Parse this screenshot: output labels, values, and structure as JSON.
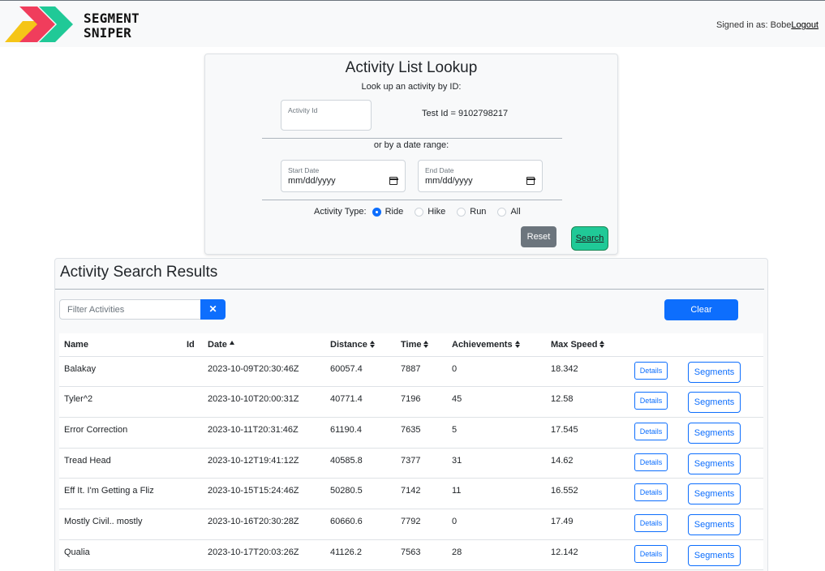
{
  "header": {
    "brand_line1": "SEGMENT",
    "brand_line2": "SNIPER",
    "signed_in_prefix": "Signed in as: Bobe",
    "logout_label": "Logout",
    "logo_colors": [
      "#f5c518",
      "#f03d5c",
      "#20c997"
    ]
  },
  "lookup": {
    "title": "Activity List Lookup",
    "by_id_text": "Look up an activity by ID:",
    "activity_id_label": "Activity Id",
    "activity_id_value": "",
    "test_id_text": "Test Id = 9102798217",
    "by_date_text": "or by a date range:",
    "start_date_label": "Start Date",
    "start_date_value": "mm/dd/yyyy",
    "end_date_label": "End Date",
    "end_date_value": "mm/dd/yyyy",
    "activity_type_label": "Activity Type:",
    "activity_types": [
      {
        "label": "Ride",
        "selected": true
      },
      {
        "label": "Hike",
        "selected": false
      },
      {
        "label": "Run",
        "selected": false
      },
      {
        "label": "All",
        "selected": false
      }
    ],
    "reset_label": "Reset",
    "search_label": "Search"
  },
  "results": {
    "title": "Activity Search Results",
    "filter_placeholder": "Filter Activities",
    "filter_clear_glyph": "✕",
    "clear_label": "Clear",
    "columns": [
      "Name",
      "Id",
      "Date",
      "Distance",
      "Time",
      "Achievements",
      "Max Speed"
    ],
    "details_label": "Details",
    "segments_label": "Segments",
    "rows": [
      {
        "name": "Balakay",
        "id": "",
        "date": "2023-10-09T20:30:46Z",
        "distance": "60057.4",
        "time": "7887",
        "achievements": "0",
        "max_speed": "18.342"
      },
      {
        "name": "Tyler^2",
        "id": "",
        "date": "2023-10-10T20:00:31Z",
        "distance": "40771.4",
        "time": "7196",
        "achievements": "45",
        "max_speed": "12.58"
      },
      {
        "name": "Error Correction",
        "id": "",
        "date": "2023-10-11T20:31:46Z",
        "distance": "61190.4",
        "time": "7635",
        "achievements": "5",
        "max_speed": "17.545"
      },
      {
        "name": "Tread Head",
        "id": "",
        "date": "2023-10-12T19:41:12Z",
        "distance": "40585.8",
        "time": "7377",
        "achievements": "31",
        "max_speed": "14.62"
      },
      {
        "name": "Eff It. I'm Getting a Fliz",
        "id": "",
        "date": "2023-10-15T15:24:46Z",
        "distance": "50280.5",
        "time": "7142",
        "achievements": "11",
        "max_speed": "16.552"
      },
      {
        "name": "Mostly Civil.. mostly",
        "id": "",
        "date": "2023-10-16T20:30:28Z",
        "distance": "60660.6",
        "time": "7792",
        "achievements": "0",
        "max_speed": "17.49"
      },
      {
        "name": "Qualia",
        "id": "",
        "date": "2023-10-17T20:03:26Z",
        "distance": "41126.2",
        "time": "7563",
        "achievements": "28",
        "max_speed": "12.142"
      }
    ]
  }
}
